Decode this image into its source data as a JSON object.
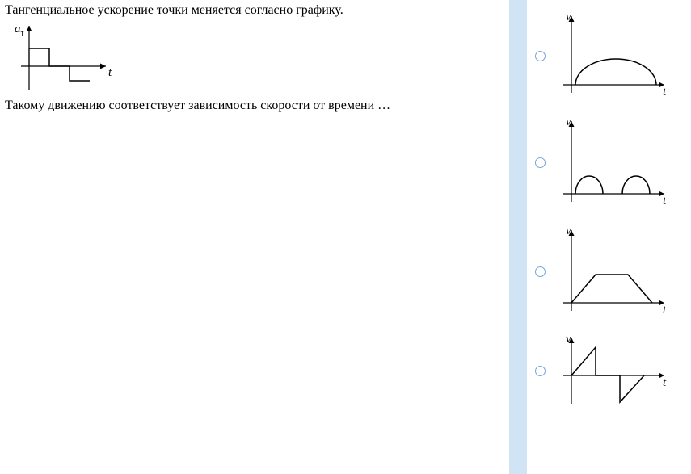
{
  "question": {
    "line1": "Тангенциальное ускорение точки меняется согласно графику.",
    "line2": "Такому движению соответствует зависимость скорости от времени …",
    "graph": {
      "y_label": "a",
      "y_sub": "τ",
      "x_label": "t"
    }
  },
  "answers": [
    {
      "id": "opt1",
      "y_label": "v",
      "x_label": "t",
      "type": "single-hump"
    },
    {
      "id": "opt2",
      "y_label": "v",
      "x_label": "t",
      "type": "double-hump"
    },
    {
      "id": "opt3",
      "y_label": "v",
      "x_label": "t",
      "type": "trapezoid"
    },
    {
      "id": "opt4",
      "y_label": "v",
      "x_label": "t",
      "type": "zigzag"
    }
  ],
  "chart_data": {
    "question_graph": {
      "type": "step-function",
      "description": "Tangential acceleration vs time: positive constant, then zero, then negative constant",
      "segments": [
        {
          "t_start": 0,
          "t_end": 1,
          "a": 1
        },
        {
          "t_start": 1,
          "t_end": 2,
          "a": 0
        },
        {
          "t_start": 2,
          "t_end": 3,
          "a": -1
        }
      ],
      "xlabel": "t",
      "ylabel": "a_τ"
    },
    "answer_graphs": [
      {
        "type": "line",
        "shape": "single semi-ellipse hump starting near origin",
        "xlabel": "t",
        "ylabel": "v"
      },
      {
        "type": "line",
        "shape": "two small humps separated by gap",
        "xlabel": "t",
        "ylabel": "v"
      },
      {
        "type": "line",
        "shape": "trapezoid: rises, flat plateau, falls back to zero",
        "xlabel": "t",
        "ylabel": "v"
      },
      {
        "type": "line",
        "shape": "sawtooth/zigzag crossing zero: up, vertical drop to zero, flat, drop below, rise back",
        "xlabel": "t",
        "ylabel": "v"
      }
    ]
  }
}
